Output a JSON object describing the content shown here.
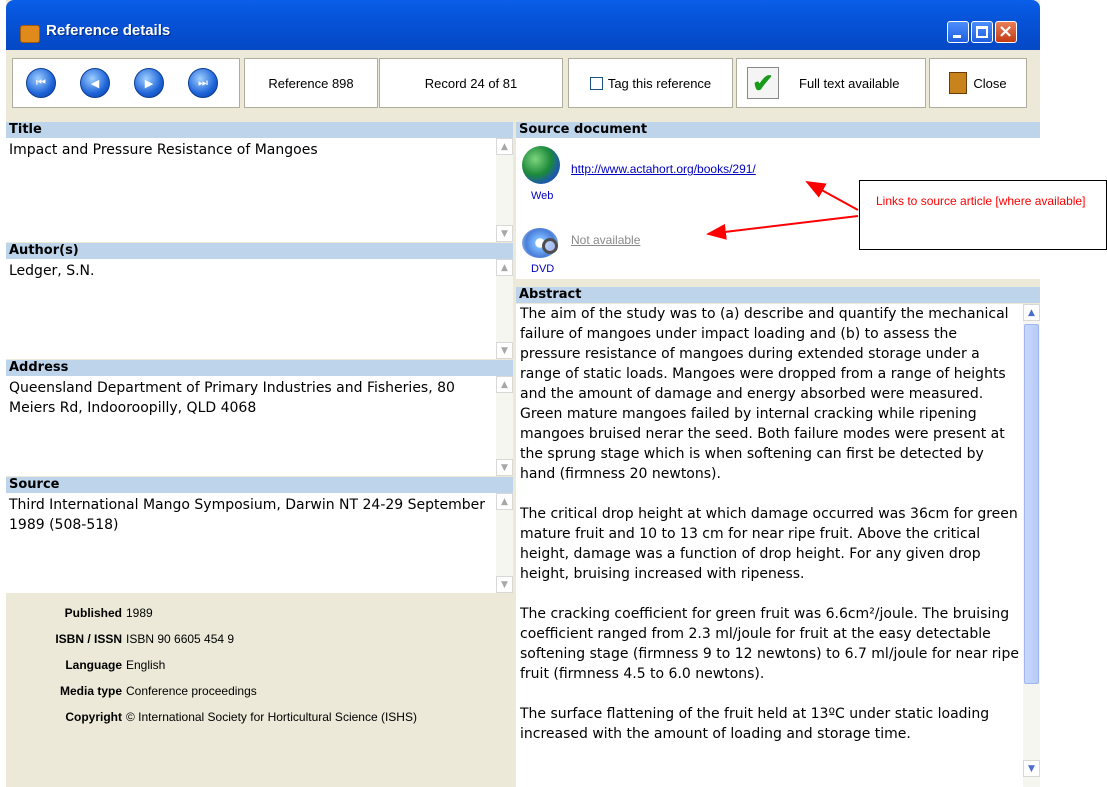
{
  "window": {
    "title": "Reference details"
  },
  "toolbar": {
    "reference_label": "Reference 898",
    "record_label": "Record 24 of 81",
    "tag_label": "Tag this reference",
    "fulltext_label": "Full text available",
    "close_label": "Close"
  },
  "left": {
    "title_header": "Title",
    "title_value": "Impact and Pressure Resistance of Mangoes",
    "author_header": "Author(s)",
    "author_value": "Ledger, S.N.",
    "address_header": "Address",
    "address_value": "Queensland Department of Primary Industries and Fisheries, 80 Meiers Rd, Indooroopilly, QLD 4068",
    "source_header": "Source",
    "source_value": "Third International Mango Symposium,  Darwin NT   24-29 September 1989 (508-518)"
  },
  "meta": {
    "published_label": "Published",
    "published_value": "1989",
    "isbn_label": "ISBN / ISSN",
    "isbn_value": "ISBN 90 6605 454 9",
    "language_label": "Language",
    "language_value": "English",
    "media_label": "Media type",
    "media_value": "Conference proceedings",
    "copyright_label": "Copyright",
    "copyright_value": "© International Society for Horticultural Science (ISHS)"
  },
  "source_doc": {
    "header": "Source document",
    "web_label": "Web",
    "web_link": "http://www.actahort.org/books/291/",
    "dvd_label": "DVD",
    "dvd_link": "Not available"
  },
  "abstract": {
    "header": "Abstract",
    "p1": "The aim of the study was to (a) describe and quantify the mechanical failure of mangoes under impact loading and (b) to assess the pressure resistance of mangoes during extended storage under a range of static loads.  Mangoes were dropped from a range of heights and the amount of damage and energy absorbed were measured.  Green mature mangoes failed by internal cracking while ripening mangoes bruised nerar the seed.  Both failure modes were present at the sprung stage which is when softening can first be detected by hand (firmness 20 newtons).",
    "p2": "The critical drop height at which damage occurred was 36cm for green mature fruit and 10 to 13 cm for near ripe fruit.  Above the critical height, damage was a function of drop height.  For any given drop height, bruising increased with ripeness.",
    "p3": "The cracking coefficient for green fruit was 6.6cm²/joule.  The bruising coefficient ranged from 2.3 ml/joule for fruit at the easy detectable softening stage (firmness 9 to 12 newtons) to 6.7 ml/joule for near ripe fruit (firmness 4.5 to 6.0 newtons).",
    "p4": "The surface flattening of the fruit held at 13ºC under static loading increased with the amount of loading and storage time."
  },
  "callout": {
    "text": "Links to source article [where available]",
    "color": "#ff0000"
  },
  "colors": {
    "titlebar": "#0653d8",
    "header_bg": "#bdd4ea",
    "link": "#0000c0",
    "link_disabled": "#8a8a8a"
  }
}
